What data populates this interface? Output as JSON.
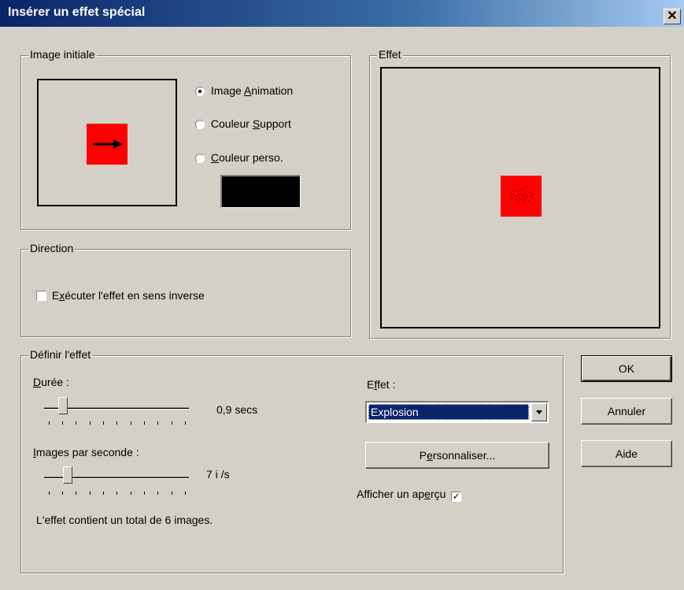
{
  "window": {
    "title": "Insérer un effet spécial",
    "close_label": "✕"
  },
  "image_initiale": {
    "legend": "Image initiale",
    "options": [
      {
        "pre": "Image ",
        "ul": "A",
        "post": "nimation",
        "selected": true
      },
      {
        "pre": "Couleur ",
        "ul": "S",
        "post": "upport",
        "selected": false
      },
      {
        "pre": "",
        "ul": "C",
        "post": "ouleur perso.",
        "selected": false
      }
    ],
    "custom_color": "#000000",
    "thumbnail_color": "#ff0000"
  },
  "effet_preview": {
    "legend": "Effet",
    "thumbnail_color": "#ff0000"
  },
  "direction": {
    "legend": "Direction",
    "reverse": {
      "pre": "E",
      "ul": "x",
      "post": "écuter l'effet en sens inverse",
      "checked": false
    }
  },
  "definir": {
    "legend": "Définir l'effet",
    "duree": {
      "pre": "",
      "ul": "D",
      "post": "urée :",
      "value_text": "0,9 secs",
      "level": 0.13
    },
    "images_par_seconde": {
      "pre": "",
      "ul": "I",
      "post": "mages par seconde :",
      "value_text": "7 i /s",
      "level": 0.18
    },
    "total_text": "L'effet contient un total de 6 images.",
    "effet_label": {
      "pre": "E",
      "ul": "f",
      "post": "fet :"
    },
    "effet_select": {
      "value": "Explosion"
    },
    "personnaliser": {
      "pre": "P",
      "ul": "e",
      "post": "rsonnaliser..."
    },
    "apercu": {
      "pre": "Afficher un ap",
      "ul": "e",
      "post": "rçu",
      "checked": true
    }
  },
  "buttons": {
    "ok": "OK",
    "annuler": "Annuler",
    "aide": "Aide"
  }
}
